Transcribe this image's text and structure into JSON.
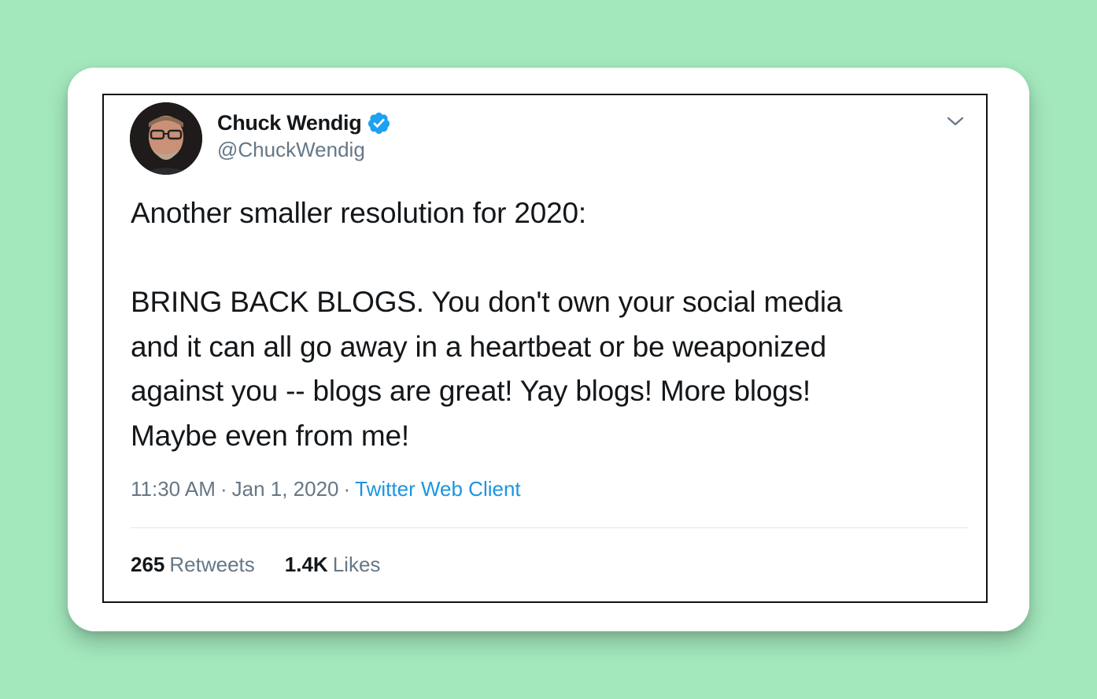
{
  "tweet": {
    "author": {
      "display_name": "Chuck Wendig",
      "handle": "@ChuckWendig",
      "verified": true,
      "avatar_icon": "user-avatar-photo"
    },
    "text": "Another smaller resolution for 2020:\n\nBRING BACK BLOGS. You don't own your social media\nand it can all go away in a heartbeat or be weaponized\nagainst you -- blogs are great! Yay blogs! More blogs!\nMaybe even from me!",
    "meta": {
      "time": "11:30 AM",
      "separator": "·",
      "date": "Jan 1, 2020",
      "source": "Twitter Web Client"
    },
    "stats": {
      "retweets_count": "265",
      "retweets_label": "Retweets",
      "likes_count": "1.4K",
      "likes_label": "Likes"
    }
  },
  "colors": {
    "background": "#a3e8bd",
    "card": "#ffffff",
    "text_primary": "#14171a",
    "text_secondary": "#657786",
    "link": "#1b95e0",
    "verified": "#1da1f2"
  }
}
